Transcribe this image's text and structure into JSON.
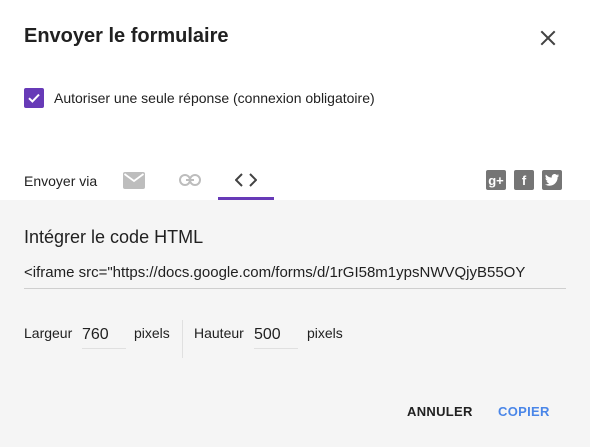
{
  "dialog": {
    "title": "Envoyer le formulaire"
  },
  "options": {
    "single_response_label": "Autoriser une seule réponse (connexion obligatoire)",
    "single_response_checked": true
  },
  "send_via": {
    "label": "Envoyer via",
    "tabs": [
      {
        "icon": "email-icon",
        "selected": false
      },
      {
        "icon": "link-icon",
        "selected": false
      },
      {
        "icon": "embed-code-icon",
        "selected": true
      }
    ],
    "social": [
      {
        "icon": "google-plus-icon",
        "glyph": "g+"
      },
      {
        "icon": "facebook-icon",
        "glyph": "f"
      },
      {
        "icon": "twitter-icon",
        "glyph": ""
      }
    ]
  },
  "embed": {
    "title": "Intégrer le code HTML",
    "code": "<iframe src=\"https://docs.google.com/forms/d/1rGI58m1ypsNWVQjyB55OY",
    "width_label": "Largeur",
    "width_value": "760",
    "width_unit": "pixels",
    "height_label": "Hauteur",
    "height_value": "500",
    "height_unit": "pixels"
  },
  "buttons": {
    "cancel": "ANNULER",
    "copy": "COPIER"
  },
  "colors": {
    "accent": "#673ab7",
    "action": "#4a86e8",
    "icon_grey": "#757575",
    "panel_bg": "#f5f5f5"
  }
}
